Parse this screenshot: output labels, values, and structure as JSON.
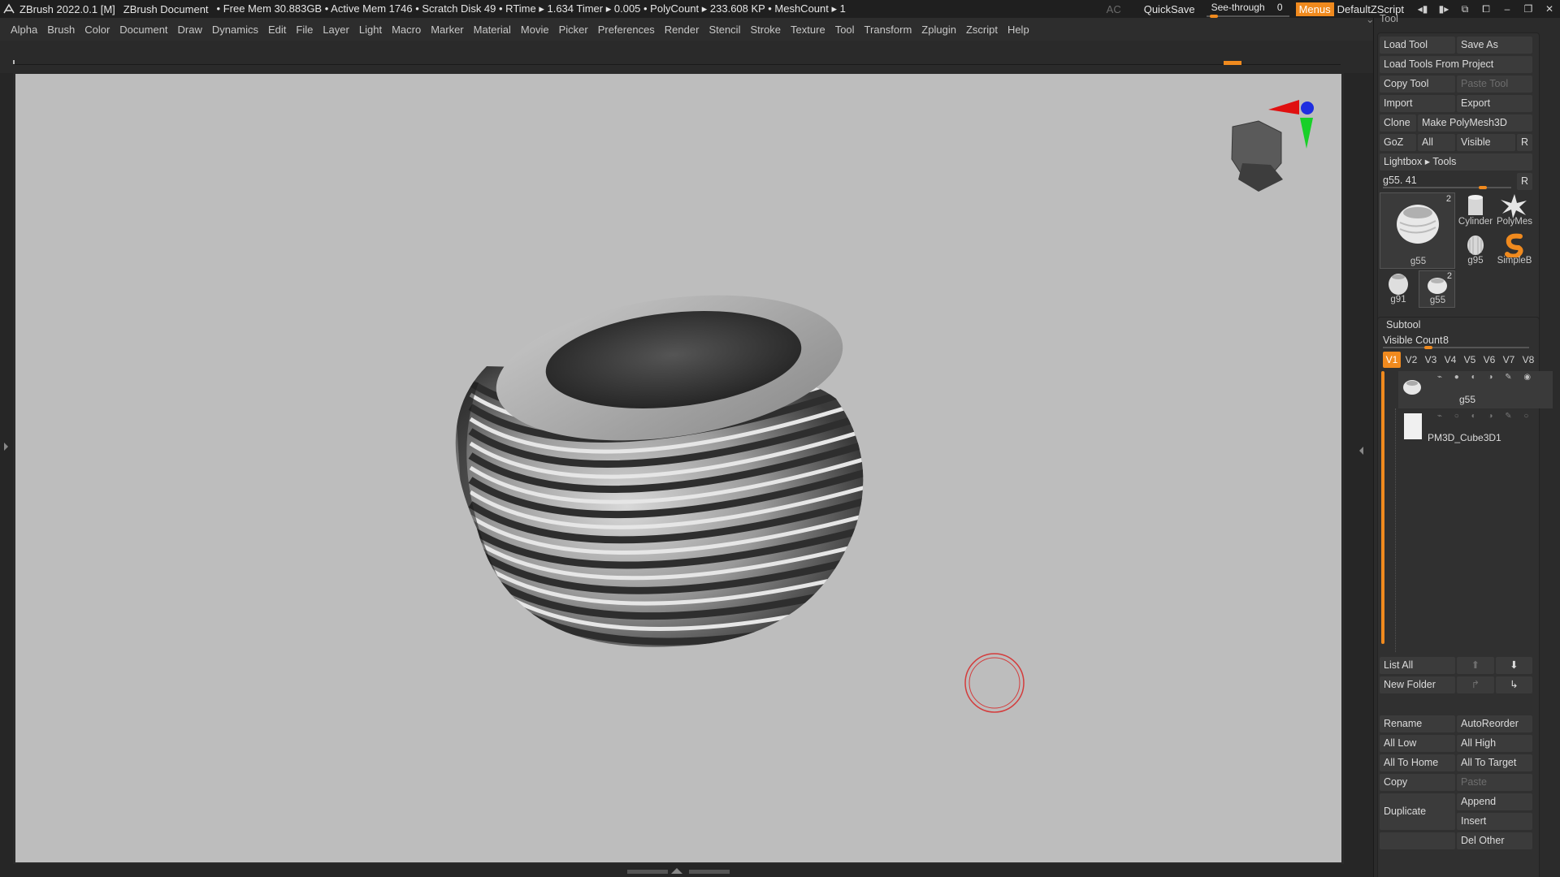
{
  "titlebar": {
    "app_title": "ZBrush 2022.0.1 [M]",
    "document": "ZBrush Document",
    "stats": "• Free Mem 30.883GB • Active Mem 1746 • Scratch Disk 49 •  RTime ▸ 1.634 Timer ▸ 0.005 • PolyCount ▸ 233.608 KP  • MeshCount ▸ 1",
    "ac_label": "AC",
    "quicksave_label": "QuickSave",
    "seethrough_label": "See-through",
    "seethrough_value": "0",
    "menus_label": "Menus",
    "script_label": "DefaultZScript"
  },
  "menubar": {
    "items": [
      "Alpha",
      "Brush",
      "Color",
      "Document",
      "Draw",
      "Dynamics",
      "Edit",
      "File",
      "Layer",
      "Light",
      "Macro",
      "Marker",
      "Material",
      "Movie",
      "Picker",
      "Preferences",
      "Render",
      "Stencil",
      "Stroke",
      "Texture",
      "Tool",
      "Transform",
      "Zplugin",
      "Zscript",
      "Help"
    ]
  },
  "tool_panel": {
    "header": "Tool",
    "load_tool": "Load Tool",
    "save_as": "Save As",
    "load_tools_from_project": "Load Tools From Project",
    "copy_tool": "Copy Tool",
    "paste_tool": "Paste Tool",
    "import": "Import",
    "export": "Export",
    "clone": "Clone",
    "make_polymesh": "Make PolyMesh3D",
    "goz": "GoZ",
    "all": "All",
    "visible": "Visible",
    "r": "R",
    "lightbox": "Lightbox ▸ Tools",
    "current_tool": "g55. 41",
    "current_tool_slider": 0.8,
    "thumbs": [
      {
        "name": "g55",
        "badge": "2"
      },
      {
        "name": "Cylinder",
        "badge": ""
      },
      {
        "name": "PolyMes",
        "badge": ""
      },
      {
        "name": "g95",
        "badge": ""
      },
      {
        "name": "SimpleB",
        "badge": ""
      },
      {
        "name": "g91",
        "badge": ""
      },
      {
        "name": "g55",
        "badge": "2"
      }
    ]
  },
  "subtool_panel": {
    "header": "Subtool",
    "visible_count_label": "Visible Count",
    "visible_count_value": "8",
    "visible_count_slider": 0.3,
    "version_tabs": [
      "V1",
      "V2",
      "V3",
      "V4",
      "V5",
      "V6",
      "V7",
      "V8"
    ],
    "active_tab": "V1",
    "subtools": [
      {
        "name": "g55",
        "selected": true
      },
      {
        "name": "PM3D_Cube3D1",
        "selected": false
      }
    ],
    "list_all": "List All",
    "new_folder": "New Folder",
    "rename": "Rename",
    "autoreorder": "AutoReorder",
    "all_low": "All Low",
    "all_high": "All High",
    "all_to_home": "All To Home",
    "all_to_target": "All To Target",
    "copy": "Copy",
    "paste": "Paste",
    "duplicate": "Duplicate",
    "append": "Append",
    "insert": "Insert",
    "del_other": "Del Other"
  },
  "colors": {
    "accent": "#f08a1e",
    "canvas": "#bdbdbd",
    "ui_bg": "#2b2b2b"
  }
}
